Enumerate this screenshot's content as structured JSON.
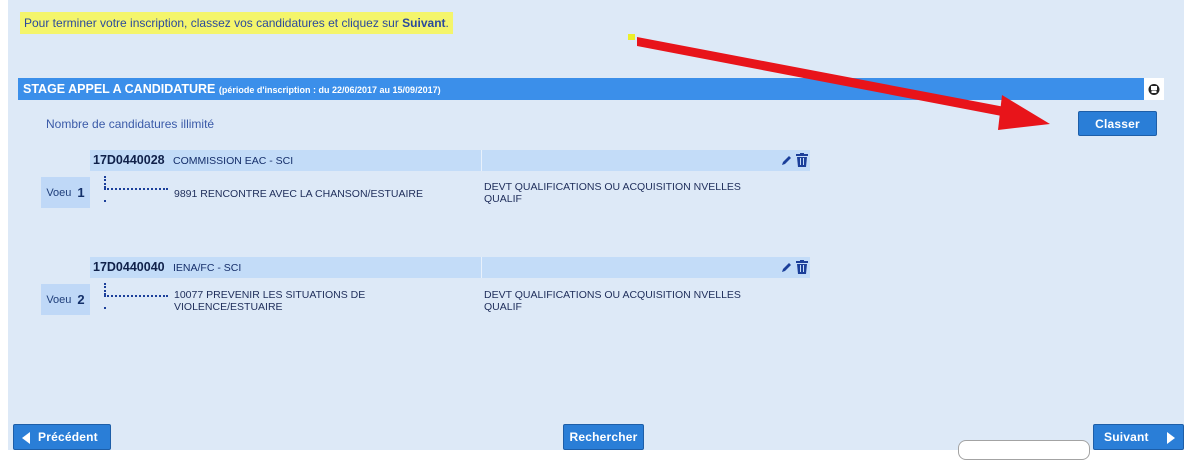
{
  "instruction": {
    "text_before": "Pour terminer votre inscription, classez vos candidatures et cliquez sur ",
    "bold_word": "Suivant",
    "text_after": "."
  },
  "section": {
    "title": "STAGE APPEL A CANDIDATURE",
    "period": "(période d'inscription : du 22/06/2017 au 15/09/2017)"
  },
  "count_text": "Nombre de candidatures illimité",
  "buttons": {
    "classer": "Classer",
    "precedent": "Précédent",
    "rechercher": "Rechercher",
    "suivant": "Suivant"
  },
  "candidatures": [
    {
      "voeu_label": "Voeu",
      "rank": "1",
      "code": "17D0440028",
      "name": "COMMISSION EAC - SCI",
      "module": "9891 RENCONTRE AVEC LA CHANSON/ESTUAIRE",
      "dispositif": "DEVT QUALIFICATIONS OU ACQUISITION NVELLES QUALIF"
    },
    {
      "voeu_label": "Voeu",
      "rank": "2",
      "code": "17D0440040",
      "name": "IENA/FC - SCI",
      "module": "10077 PREVENIR LES SITUATIONS DE VIOLENCE/ESTUAIRE",
      "dispositif": "DEVT QUALIFICATIONS OU ACQUISITION NVELLES QUALIF"
    }
  ],
  "colors": {
    "page_background": "#dde9f7",
    "header_blue": "#3b8fea",
    "button_blue": "#2a7ed7",
    "highlight_yellow": "#f4f56b",
    "annotation_red": "#e8141a"
  },
  "icons": [
    "print-icon",
    "edit-pencil-icon",
    "trash-icon",
    "chevron-left-icon",
    "chevron-right-icon"
  ]
}
